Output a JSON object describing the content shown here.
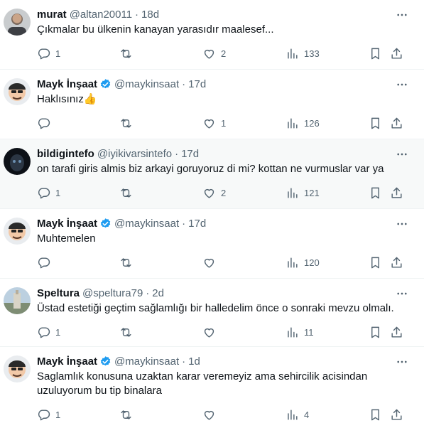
{
  "tweets": [
    {
      "name": "murat",
      "handle": "@altan20011",
      "dot": "·",
      "time": "18d",
      "verified": false,
      "text": "Çıkmalar bu ülkenin kanayan yarasıdır maalesef...",
      "replies": "1",
      "retweets": "",
      "likes": "2",
      "views": "133",
      "avatar_color": "#8a8f93"
    },
    {
      "name": "Mayk İnşaat",
      "handle": "@maykinsaat",
      "dot": "·",
      "time": "17d",
      "verified": true,
      "text": "Haklısınız👍",
      "replies": "",
      "retweets": "",
      "likes": "1",
      "views": "126",
      "avatar_color": "#f2c9a8"
    },
    {
      "name": "bildigintefo",
      "handle": "@iyikivarsintefo",
      "dot": "·",
      "time": "17d",
      "verified": false,
      "text": "on tarafi giris almis biz arkayi goruyoruz di mi? kottan ne vurmuslar var ya",
      "replies": "1",
      "retweets": "",
      "likes": "2",
      "views": "121",
      "avatar_color": "#1c2430"
    },
    {
      "name": "Mayk İnşaat",
      "handle": "@maykinsaat",
      "dot": "·",
      "time": "17d",
      "verified": true,
      "text": "Muhtemelen",
      "replies": "",
      "retweets": "",
      "likes": "",
      "views": "120",
      "avatar_color": "#f2c9a8"
    },
    {
      "name": "Speltura",
      "handle": "@speltura79",
      "dot": "·",
      "time": "2d",
      "verified": false,
      "text": "Üstad estetiği geçtim sağlamlığı bir halledelim önce o sonraki mevzu olmalı.",
      "replies": "1",
      "retweets": "",
      "likes": "",
      "views": "11",
      "avatar_color": "#a7b6c2"
    },
    {
      "name": "Mayk İnşaat",
      "handle": "@maykinsaat",
      "dot": "·",
      "time": "1d",
      "verified": true,
      "text": "Saglamlık konusuna uzaktan karar veremeyiz ama sehircilik acisindan uzuluyorum bu tip binalara",
      "replies": "1",
      "retweets": "",
      "likes": "",
      "views": "4",
      "avatar_color": "#f2c9a8"
    }
  ],
  "colors": {
    "text": "#0f1419",
    "muted": "#536471",
    "verified": "#1d9bf0",
    "border": "#eff3f4"
  },
  "icons": [
    "more-icon",
    "reply-icon",
    "retweet-icon",
    "like-icon",
    "views-icon",
    "bookmark-icon",
    "share-icon",
    "verified-badge-icon"
  ]
}
